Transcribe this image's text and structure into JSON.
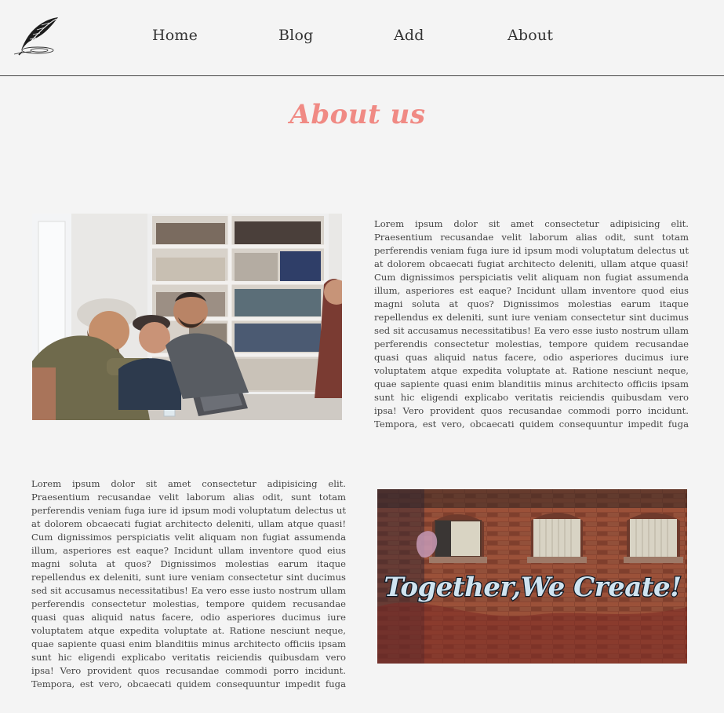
{
  "nav": {
    "logo_icon": "quill-pen-icon",
    "items": [
      {
        "label": "Home"
      },
      {
        "label": "Blog"
      },
      {
        "label": "Add"
      },
      {
        "label": "About"
      }
    ]
  },
  "page": {
    "title": "About us",
    "title_color": "#f08a84"
  },
  "sections": {
    "first": {
      "image_icon": "team-photo-image",
      "text": "Lorem ipsum dolor sit amet consectetur adipisicing elit. Praesentium recusandae velit laborum alias odit, sunt totam perferendis veniam fuga iure id ipsum modi voluptatum delectus ut at dolorem obcaecati fugiat architecto deleniti, ullam atque quasi! Cum dignissimos perspiciatis velit aliquam non fugiat assumenda illum, asperiores est eaque? Incidunt ullam inventore quod eius magni soluta at quos? Dignissimos molestias earum itaque repellendus ex deleniti, sunt iure veniam consectetur sint ducimus sed sit accusamus necessitatibus! Ea vero esse iusto nostrum ullam perferendis consectetur molestias, tempore quidem recusandae quasi quas aliquid natus facere, odio asperiores ducimus iure voluptatem atque expedita voluptate at. Ratione nesciunt neque, quae sapiente quasi enim blanditiis minus architecto officiis ipsam sunt hic eligendi explicabo veritatis reiciendis quibusdam vero ipsa! Vero provident quos recusandae commodi porro incidunt. Tempora, est vero, obcaecati quidem consequuntur impedit fuga omnis laboriosam perspiciatis deserunt"
    },
    "second": {
      "image_icon": "graffiti-wall-image",
      "graffiti_text": "Together We Create!",
      "text": "Lorem ipsum dolor sit amet consectetur adipisicing elit. Praesentium recusandae velit laborum alias odit, sunt totam perferendis veniam fuga iure id ipsum modi voluptatum delectus ut at dolorem obcaecati fugiat architecto deleniti, ullam atque quasi! Cum dignissimos perspiciatis velit aliquam non fugiat assumenda illum, asperiores est eaque? Incidunt ullam inventore quod eius magni soluta at quos? Dignissimos molestias earum itaque repellendus ex deleniti, sunt iure veniam consectetur sint ducimus sed sit accusamus necessitatibus! Ea vero esse iusto nostrum ullam perferendis consectetur molestias, tempore quidem recusandae quasi quas aliquid natus facere, odio asperiores ducimus iure voluptatem atque expedita voluptate at. Ratione nesciunt neque, quae sapiente quasi enim blanditiis minus architecto officiis ipsam sunt hic eligendi explicabo veritatis reiciendis quibusdam vero ipsa! Vero provident quos recusandae commodi porro incidunt. Tempora, est vero, obcaecati quidem consequuntur impedit fuga omnis laboriosam perspiciatis deserunt"
    }
  }
}
